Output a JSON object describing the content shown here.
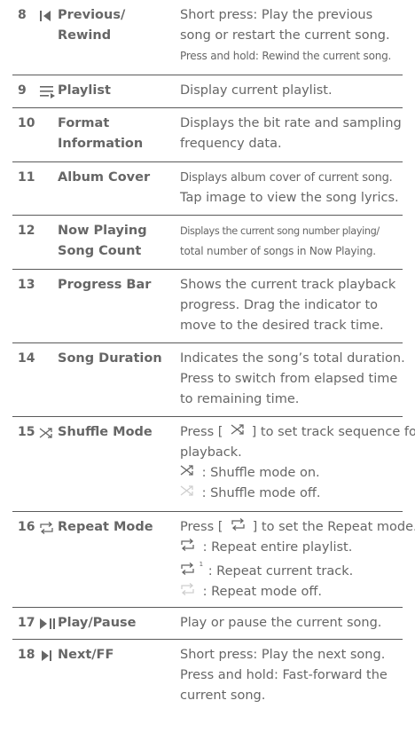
{
  "rows": [
    {
      "num": "8",
      "icon": "rewind-icon",
      "label": [
        "Previous/",
        "Rewind"
      ],
      "desc": [
        "Short press: Play the previous",
        "song or restart the current song.",
        "Press and hold: Rewind the current song."
      ]
    },
    {
      "num": "9",
      "icon": "playlist-icon",
      "label": [
        "Playlist"
      ],
      "desc": [
        "Display current playlist."
      ]
    },
    {
      "num": "10",
      "icon": "",
      "label": [
        "Format",
        "Information"
      ],
      "desc": [
        "Displays the bit rate and sampling",
        "frequency data."
      ]
    },
    {
      "num": "11",
      "icon": "",
      "label": [
        "Album Cover"
      ],
      "desc": [
        "Displays album cover of current song.",
        "Tap image to view the song lyrics."
      ]
    },
    {
      "num": "12",
      "icon": "",
      "label": [
        "Now Playing",
        "Song Count"
      ],
      "desc": [
        "Displays the current song number playing/",
        "total number of songs in Now Playing."
      ]
    },
    {
      "num": "13",
      "icon": "",
      "label": [
        "Progress Bar"
      ],
      "desc": [
        "Shows the current track playback",
        "progress. Drag the indicator to",
        "move to the desired track time."
      ]
    },
    {
      "num": "14",
      "icon": "",
      "label": [
        "Song Duration"
      ],
      "desc": [
        "Indicates the song’s total duration.",
        "Press to switch from elapsed time",
        "to remaining time."
      ]
    },
    {
      "num": "15",
      "icon": "shuffle-icon",
      "label": [
        "Shuffle Mode"
      ],
      "desc": [
        "Press [",
        "] to set track sequence for",
        "playback."
      ],
      "subs": [
        ": Shuffle mode on.",
        ": Shuffle mode off."
      ]
    },
    {
      "num": "16",
      "icon": "repeat-icon",
      "label": [
        "Repeat Mode"
      ],
      "desc": [
        "Press [",
        "] to set the Repeat mode."
      ],
      "subs": [
        ": Repeat entire playlist.",
        ": Repeat current track.",
        ": Repeat mode off."
      ],
      "repeat_one_mark": "1"
    },
    {
      "num": "17",
      "icon": "play-pause-icon",
      "label": [
        "Play/Pause"
      ],
      "desc": [
        "Play or pause the current song."
      ]
    },
    {
      "num": "18",
      "icon": "next-icon",
      "label": [
        "Next/FF"
      ],
      "desc": [
        "Short press: Play the next song.",
        "Press and hold: Fast-forward the",
        "current song."
      ]
    }
  ]
}
